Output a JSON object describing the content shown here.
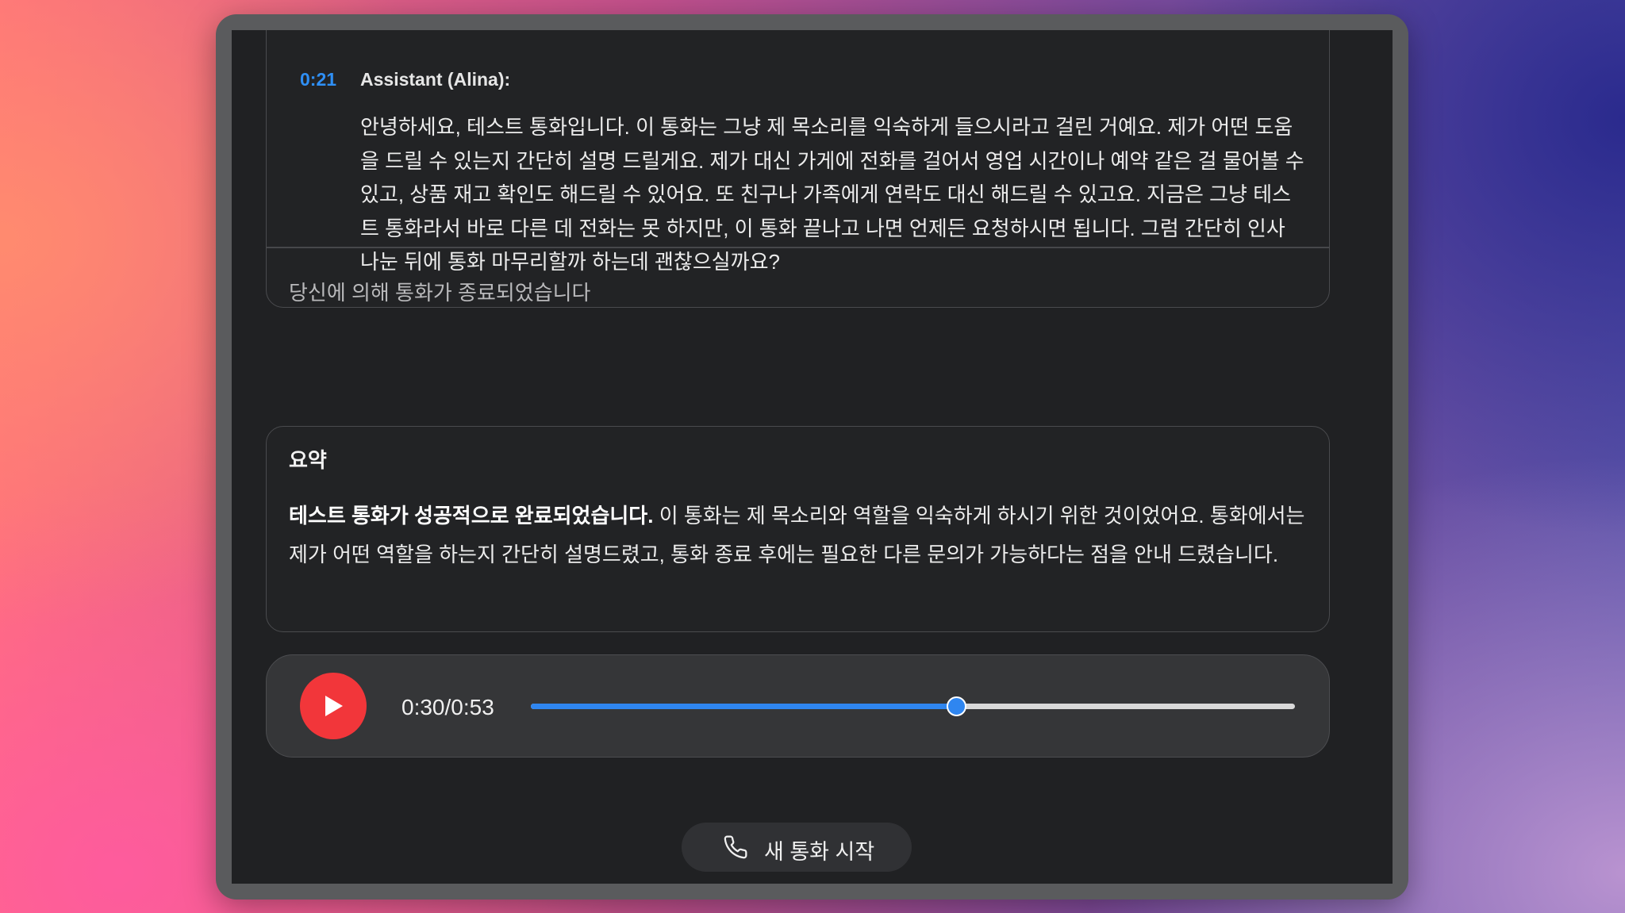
{
  "transcript": {
    "timestamp": "0:21",
    "speaker": "Assistant (Alina):",
    "message": "안녕하세요, 테스트 통화입니다. 이 통화는 그냥 제 목소리를 익숙하게 들으시라고 걸린 거예요. 제가 어떤 도움을 드릴 수 있는지 간단히 설명 드릴게요. 제가 대신 가게에 전화를 걸어서 영업 시간이나 예약 같은 걸 물어볼 수 있고, 상품 재고 확인도 해드릴 수 있어요. 또 친구나 가족에게 연락도 대신 해드릴 수 있고요. 지금은 그냥 테스트 통화라서 바로 다른 데 전화는 못 하지만, 이 통화 끝나고 나면 언제든 요청하시면 됩니다. 그럼 간단히 인사 나눈 뒤에 통화 마무리할까 하는데 괜찮으실까요?",
    "ended_status": "당신에 의해 통화가 종료되었습니다"
  },
  "summary": {
    "title": "요약",
    "lead": "테스트 통화가 성공적으로 완료되었습니다.",
    "body": " 이 통화는 제 목소리와 역할을 익숙하게 하시기 위한 것이었어요. 통화에서는 제가 어떤 역할을 하는지 간단히 설명드렸고, 통화 종료 후에는 필요한 다른 문의가 가능하다는 점을 안내 드렸습니다."
  },
  "player": {
    "time_display": "0:30/0:53",
    "progress": 0.5566,
    "play_icon": "play-icon",
    "accent_color": "#2f86f0",
    "play_color": "#f2363a"
  },
  "actions": {
    "new_call_label": "새 통화 시작",
    "new_call_icon": "phone-icon"
  }
}
